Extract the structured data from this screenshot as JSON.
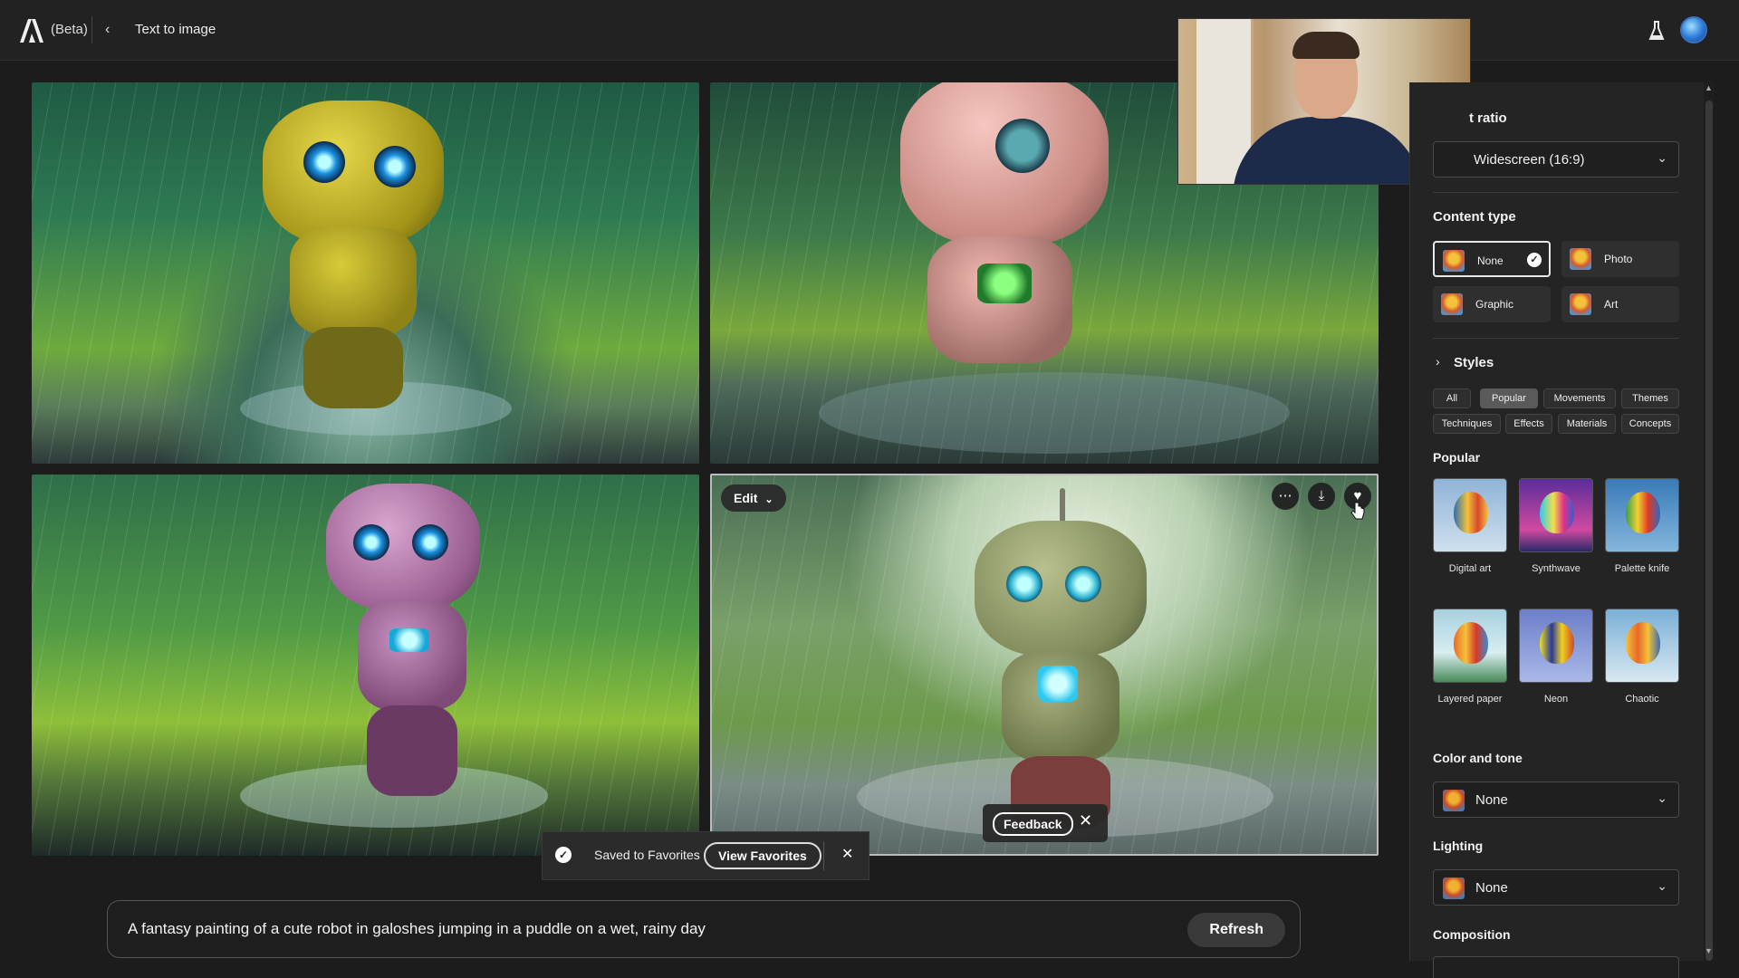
{
  "header": {
    "beta_label": "(Beta)",
    "breadcrumb": "Text to image"
  },
  "images": {
    "edit_label": "Edit"
  },
  "feedback": {
    "label": "Feedback"
  },
  "toast": {
    "message": "Saved to Favorites",
    "button": "View Favorites"
  },
  "prompt": {
    "text": "A fantasy painting of a cute robot in galoshes jumping in a puddle on a wet, rainy day",
    "refresh_label": "Refresh"
  },
  "panel": {
    "aspect_ratio_heading": "t ratio",
    "aspect_ratio_value": "Widescreen (16:9)",
    "content_type_heading": "Content type",
    "content_types": [
      {
        "label": "None",
        "selected": true
      },
      {
        "label": "Photo",
        "selected": false
      },
      {
        "label": "Graphic",
        "selected": false
      },
      {
        "label": "Art",
        "selected": false
      }
    ],
    "styles_heading": "Styles",
    "style_tabs": [
      "All",
      "Popular",
      "Movements",
      "Themes",
      "Techniques",
      "Effects",
      "Materials",
      "Concepts"
    ],
    "style_tab_active": "Popular",
    "popular_heading": "Popular",
    "popular_styles": [
      "Digital art",
      "Synthwave",
      "Palette knife",
      "Layered paper",
      "Neon",
      "Chaotic"
    ],
    "color_tone_heading": "Color and tone",
    "color_tone_value": "None",
    "lighting_heading": "Lighting",
    "lighting_value": "None",
    "composition_heading": "Composition"
  },
  "colors": {
    "background": "#1c1c1c",
    "panel": "#242424",
    "accent_text": "#ffffff"
  }
}
